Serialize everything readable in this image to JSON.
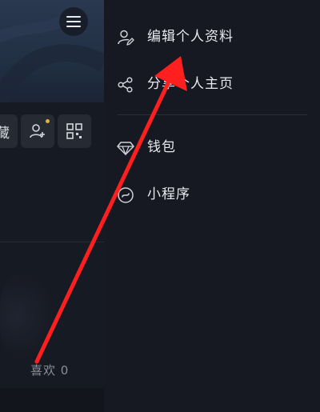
{
  "background_page": {
    "collect_chip_text": "藏",
    "likes_label": "喜欢 0"
  },
  "icons": {
    "menu": "hamburger-menu-icon",
    "add_friend": "add-friend-icon",
    "qr": "qr-code-icon"
  },
  "drawer": {
    "items": [
      {
        "label": "编辑个人资料",
        "icon": "user-edit-icon"
      },
      {
        "label": "分享个人主页",
        "icon": "share-icon"
      },
      {
        "label": "钱包",
        "icon": "diamond-icon"
      },
      {
        "label": "小程序",
        "icon": "mini-program-icon"
      }
    ]
  },
  "colors": {
    "annotation_arrow": "#ff1f1f",
    "notify_dot": "#e6b33a",
    "drawer_bg": "#161922",
    "text_primary": "#e7e9ee"
  }
}
